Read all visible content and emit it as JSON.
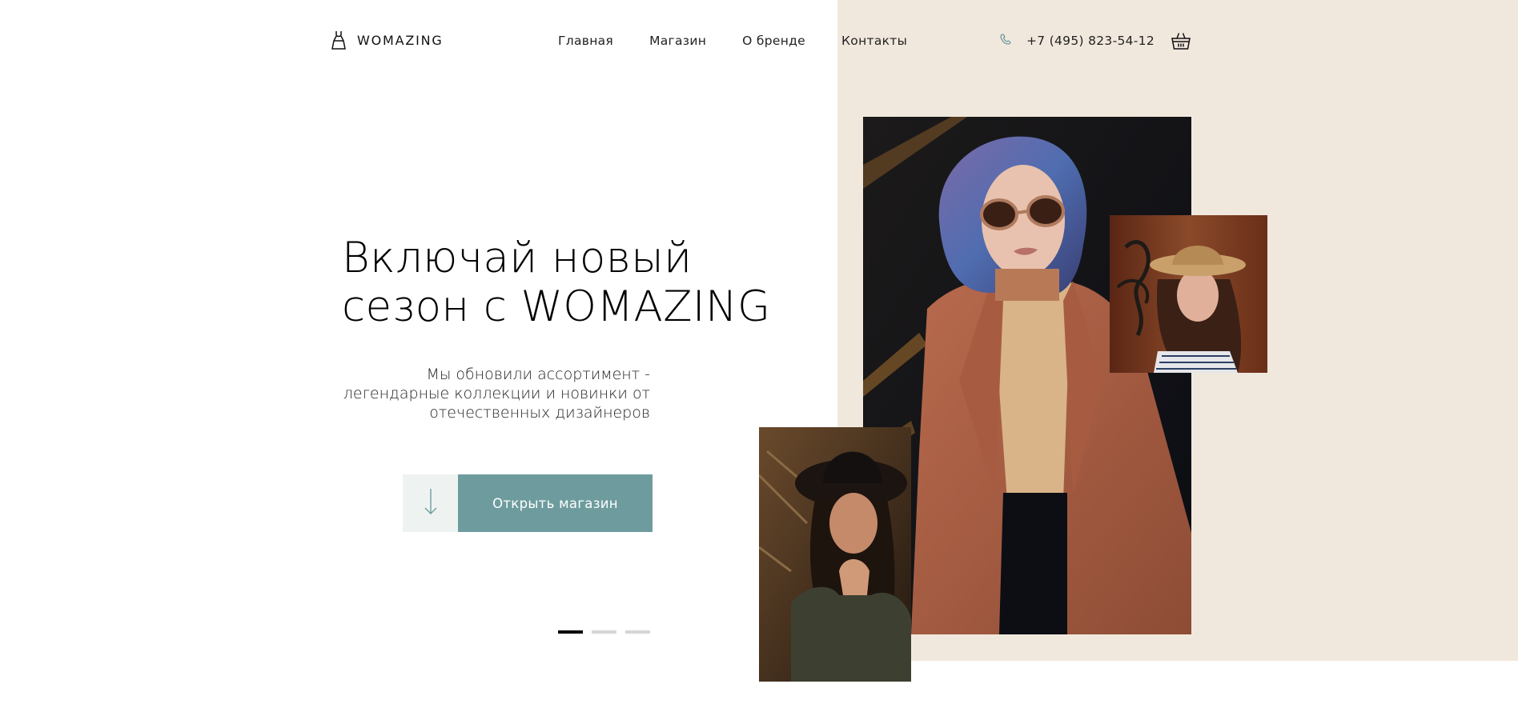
{
  "header": {
    "logo_text": "WOMAZING",
    "nav": [
      {
        "label": "Главная"
      },
      {
        "label": "Магазин"
      },
      {
        "label": "О бренде"
      },
      {
        "label": "Контакты"
      }
    ],
    "phone": "+7 (495) 823-54-12",
    "icons": {
      "logo": "dress-icon",
      "phone": "phone-icon",
      "cart": "shopping-basket-icon"
    }
  },
  "hero": {
    "title_line1": "Включай новый",
    "title_line2": "сезон с WOMAZING",
    "subtitle_line1": "Мы обновили ассортимент -",
    "subtitle_line2": "легендарные коллекции и новинки от",
    "subtitle_line3": "отечественных дизайнеров",
    "cta_label": "Открыть магазин",
    "cta_icon": "arrow-down-icon",
    "slides_total": 3,
    "active_slide": 1
  },
  "images": {
    "main": "woman-in-brown-coat-sunglasses-photo",
    "top_right": "woman-in-straw-hat-photo",
    "bottom_left": "woman-in-black-hat-photo"
  },
  "colors": {
    "accent": "#6e9c9e",
    "accent_light": "#eef3f2",
    "beige": "#f1e8dd",
    "text": "#111111"
  }
}
